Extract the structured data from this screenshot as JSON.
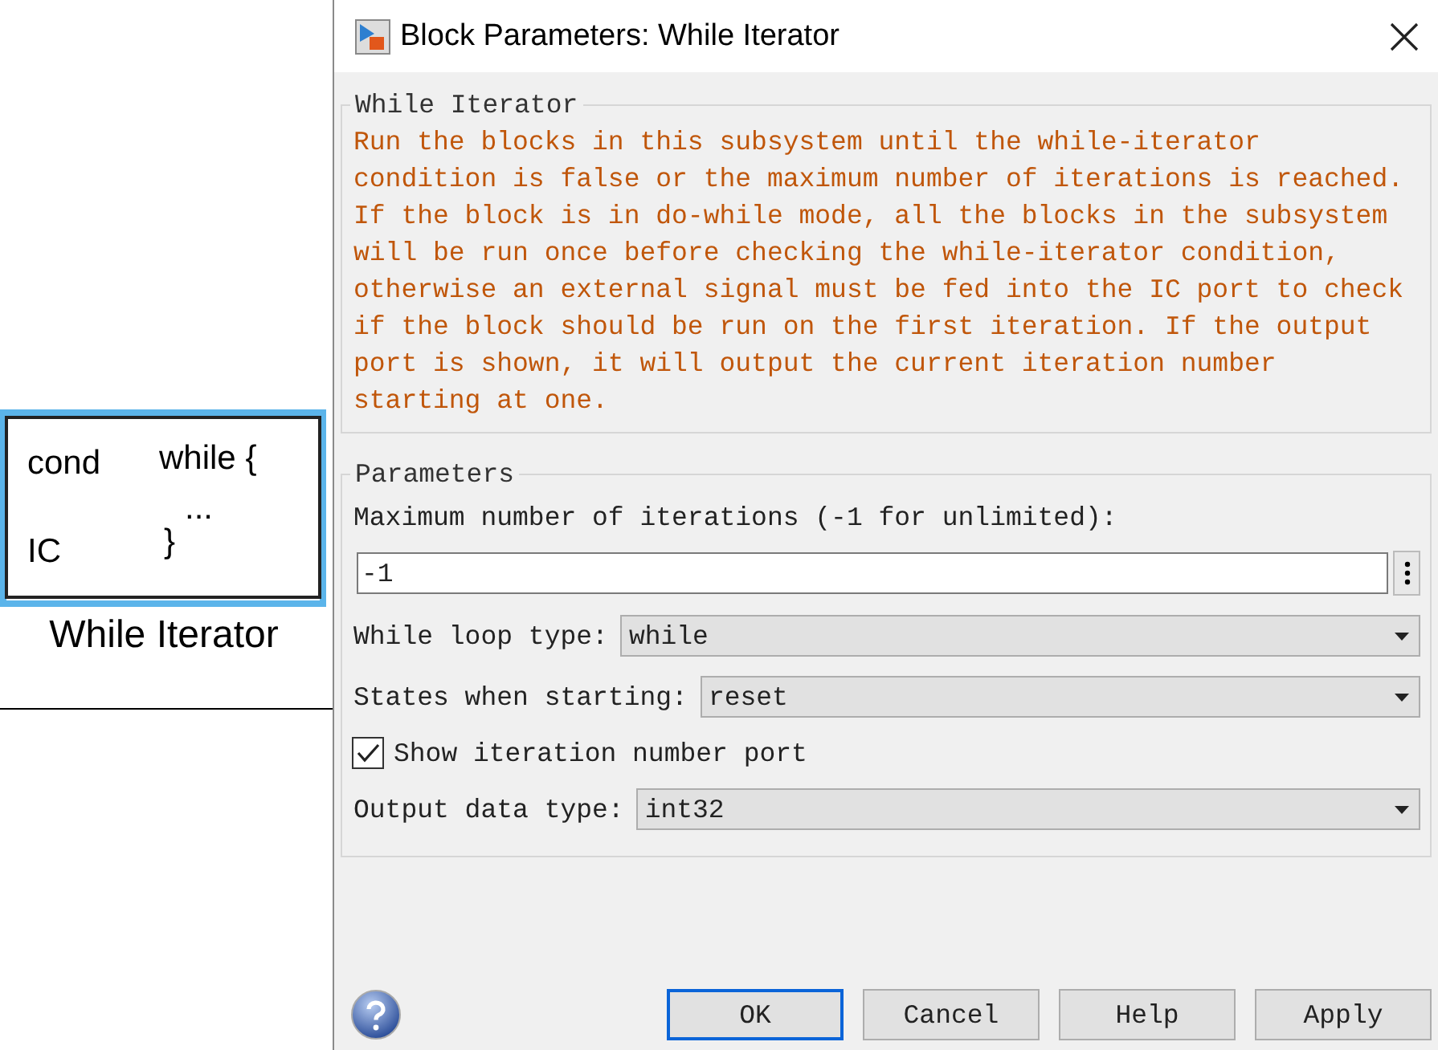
{
  "canvas": {
    "block": {
      "selected": true,
      "ports": [
        "cond",
        "IC"
      ],
      "body": [
        "while {",
        "...",
        "}"
      ],
      "name": "While Iterator"
    }
  },
  "dialog": {
    "title": "Block Parameters: While Iterator",
    "description": {
      "title": "While Iterator",
      "text": "Run the blocks in this subsystem until the while-iterator condition is false or the maximum number of iterations is reached. If the block is in do-while mode, all the blocks in the subsystem will be run once before checking the while-iterator condition, otherwise an external signal must be fed into the IC port to check if the block should be run on the first iteration. If the output port is shown, it will output the current iteration number starting at one."
    },
    "parameters": {
      "title": "Parameters",
      "items": [
        {
          "kind": "text",
          "label": "Maximum number of iterations (-1 for unlimited):",
          "value": "-1"
        },
        {
          "kind": "dropdown",
          "label": "While loop type:",
          "value": "while"
        },
        {
          "kind": "dropdown",
          "label": "States when starting:",
          "value": "reset"
        },
        {
          "kind": "checkbox",
          "label": "Show iteration number port",
          "checked": true
        },
        {
          "kind": "dropdown",
          "label": "Output data type:",
          "value": "int32"
        }
      ]
    },
    "buttons": [
      {
        "label": "OK",
        "default": true
      },
      {
        "label": "Cancel",
        "default": false
      },
      {
        "label": "Help",
        "default": false
      },
      {
        "label": "Apply",
        "default": false
      }
    ]
  }
}
